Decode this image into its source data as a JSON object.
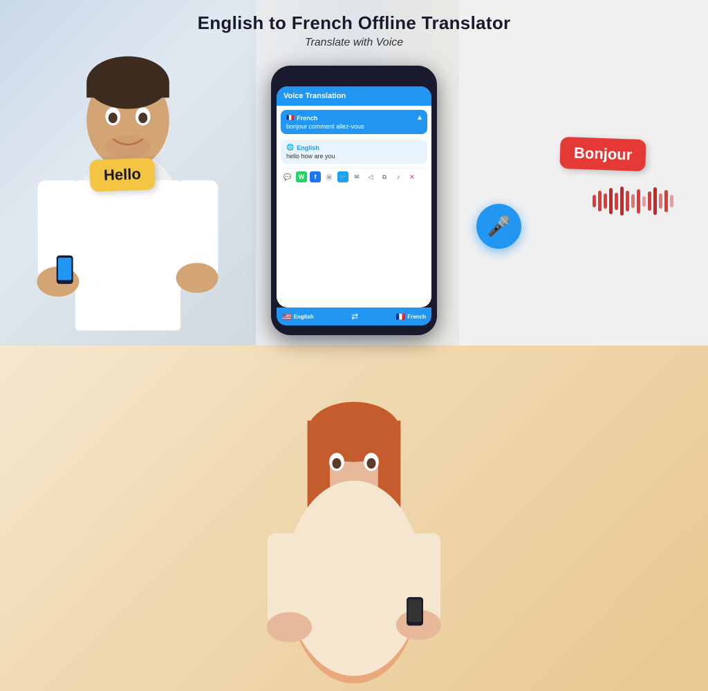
{
  "header": {
    "title": "English to French Offline Translator",
    "subtitle": "Translate with Voice"
  },
  "app": {
    "screen_title": "Voice Translation",
    "french_lang": "French",
    "french_text": "bonjour comment allez-vous",
    "english_lang": "English",
    "english_text": "hello how are you",
    "bottom_lang_left": "English",
    "bottom_lang_right": "French"
  },
  "bubbles": {
    "hello": "Hello",
    "bonjour": "Bonjour"
  },
  "icons": {
    "mic": "🎤",
    "swap": "⇄",
    "whatsapp": "W",
    "messenger": "M",
    "facebook": "f",
    "twitter": "🐦",
    "chat": "💬",
    "share": "◁",
    "copy": "⧉",
    "volume": "♪",
    "close": "✕",
    "chevron_up": "▲"
  }
}
